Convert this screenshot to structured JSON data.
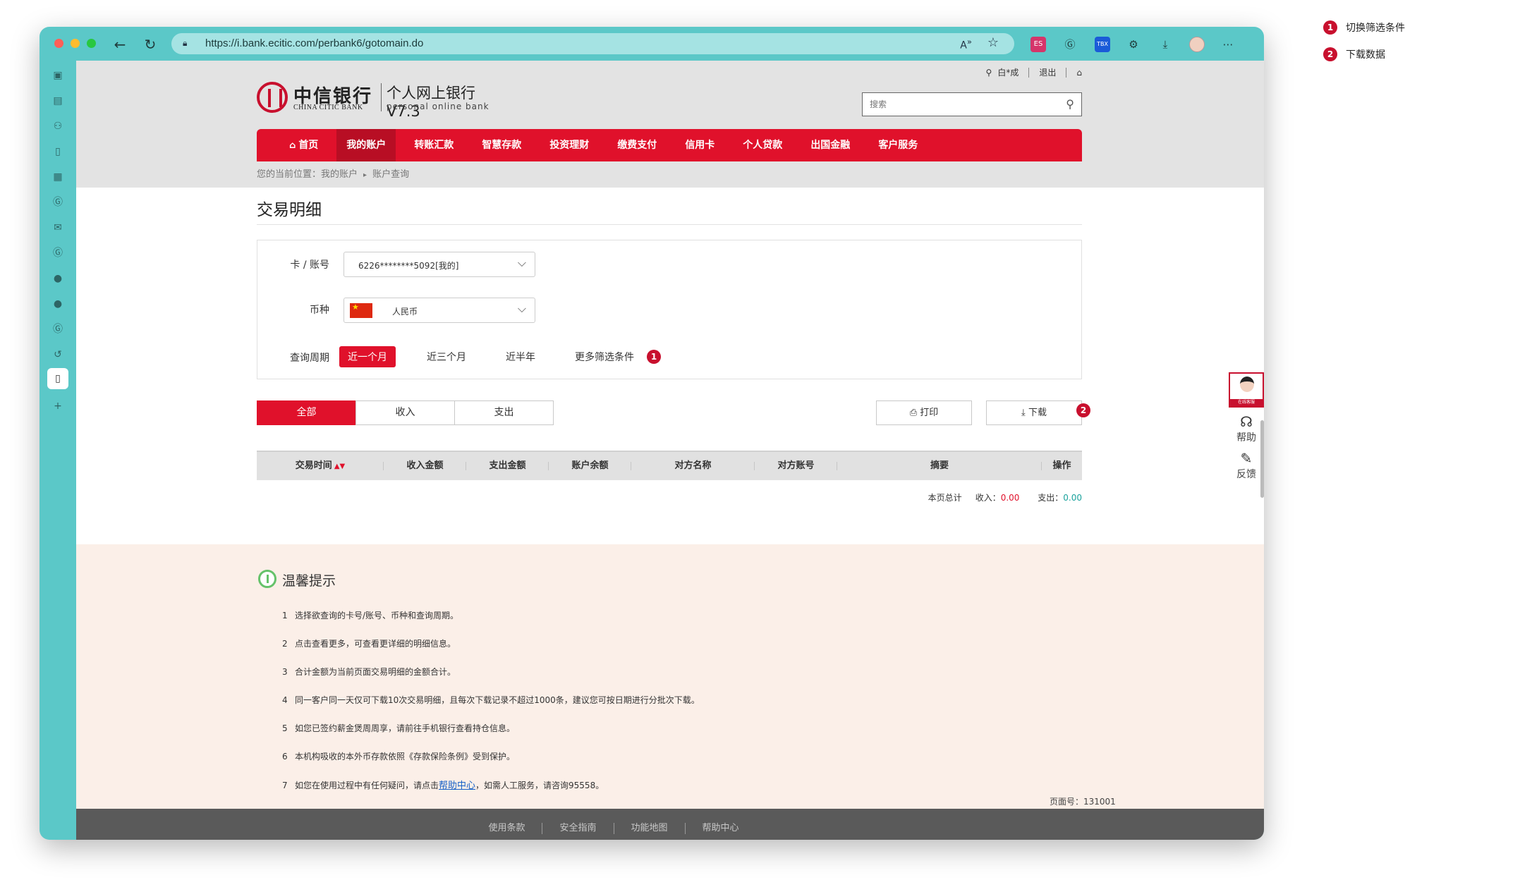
{
  "browser": {
    "url": "https://i.bank.ecitic.com/perbank6/gotomain.do",
    "reader_label": "A",
    "ext_pink": "ES",
    "ext_blue": "TBX"
  },
  "header": {
    "bank_cn": "中信银行",
    "bank_en": "CHINA CITIC BANK",
    "product_cn": "个人网上银行 V7.3",
    "product_en": "personal online bank",
    "username": "白*成",
    "logout": "退出",
    "search_placeholder": "搜索"
  },
  "nav": {
    "items": [
      {
        "label": "首页"
      },
      {
        "label": "我的账户"
      },
      {
        "label": "转账汇款"
      },
      {
        "label": "智慧存款"
      },
      {
        "label": "投资理财"
      },
      {
        "label": "缴费支付"
      },
      {
        "label": "信用卡"
      },
      {
        "label": "个人贷款"
      },
      {
        "label": "出国金融"
      },
      {
        "label": "客户服务"
      }
    ],
    "active_index": 1
  },
  "breadcrumb": {
    "prefix": "您的当前位置：",
    "level1": "我的账户",
    "level2": "账户查询"
  },
  "page_title": "交易明细",
  "filter": {
    "card_label": "卡 / 账号",
    "card_value": "6226********5092[我的]",
    "currency_label": "币种",
    "currency_value": "人民币",
    "period_label": "查询周期",
    "periods": [
      "近一个月",
      "近三个月",
      "近半年",
      "更多筛选条件"
    ],
    "active_period": 0
  },
  "annotations": {
    "badge1": "1",
    "badge2": "2",
    "legend1": "切换筛选条件",
    "legend2": "下载数据"
  },
  "tabs": [
    "全部",
    "收入",
    "支出"
  ],
  "actions": {
    "print": "打印",
    "download": "下载"
  },
  "table": {
    "columns": [
      "交易时间",
      "收入金额",
      "支出金额",
      "账户余额",
      "对方名称",
      "对方账号",
      "摘要",
      "操作"
    ]
  },
  "totals": {
    "label": "本页总计",
    "income_label": "收入：",
    "income_value": "0.00",
    "expense_label": "支出：",
    "expense_value": "0.00"
  },
  "tips": {
    "title": "温馨提示",
    "items": [
      {
        "n": "1",
        "text": "选择欲查询的卡号/账号、币种和查询周期。"
      },
      {
        "n": "2",
        "text": "点击查看更多，可查看更详细的明细信息。"
      },
      {
        "n": "3",
        "text": "合计金额为当前页面交易明细的金额合计。"
      },
      {
        "n": "4",
        "text": "同一客户同一天仅可下载10次交易明细，且每次下载记录不超过1000条，建议您可按日期进行分批次下载。"
      },
      {
        "n": "5",
        "text": "如您已签约薪金煲周周享，请前往手机银行查看持仓信息。"
      },
      {
        "n": "6",
        "text": "本机构吸收的本外币存款依照《存款保险条例》受到保护。"
      }
    ],
    "last_n": "7",
    "last_pre": "如您在使用过程中有任何疑问，请点击",
    "last_link": "帮助中心",
    "last_post": "，如需人工服务，请咨询95558。",
    "page_no": "页面号：131001"
  },
  "footer": [
    "使用条款",
    "安全指南",
    "功能地图",
    "帮助中心"
  ],
  "float": {
    "agent_strip": "在线客服",
    "help": "帮助",
    "feedback": "反馈"
  }
}
